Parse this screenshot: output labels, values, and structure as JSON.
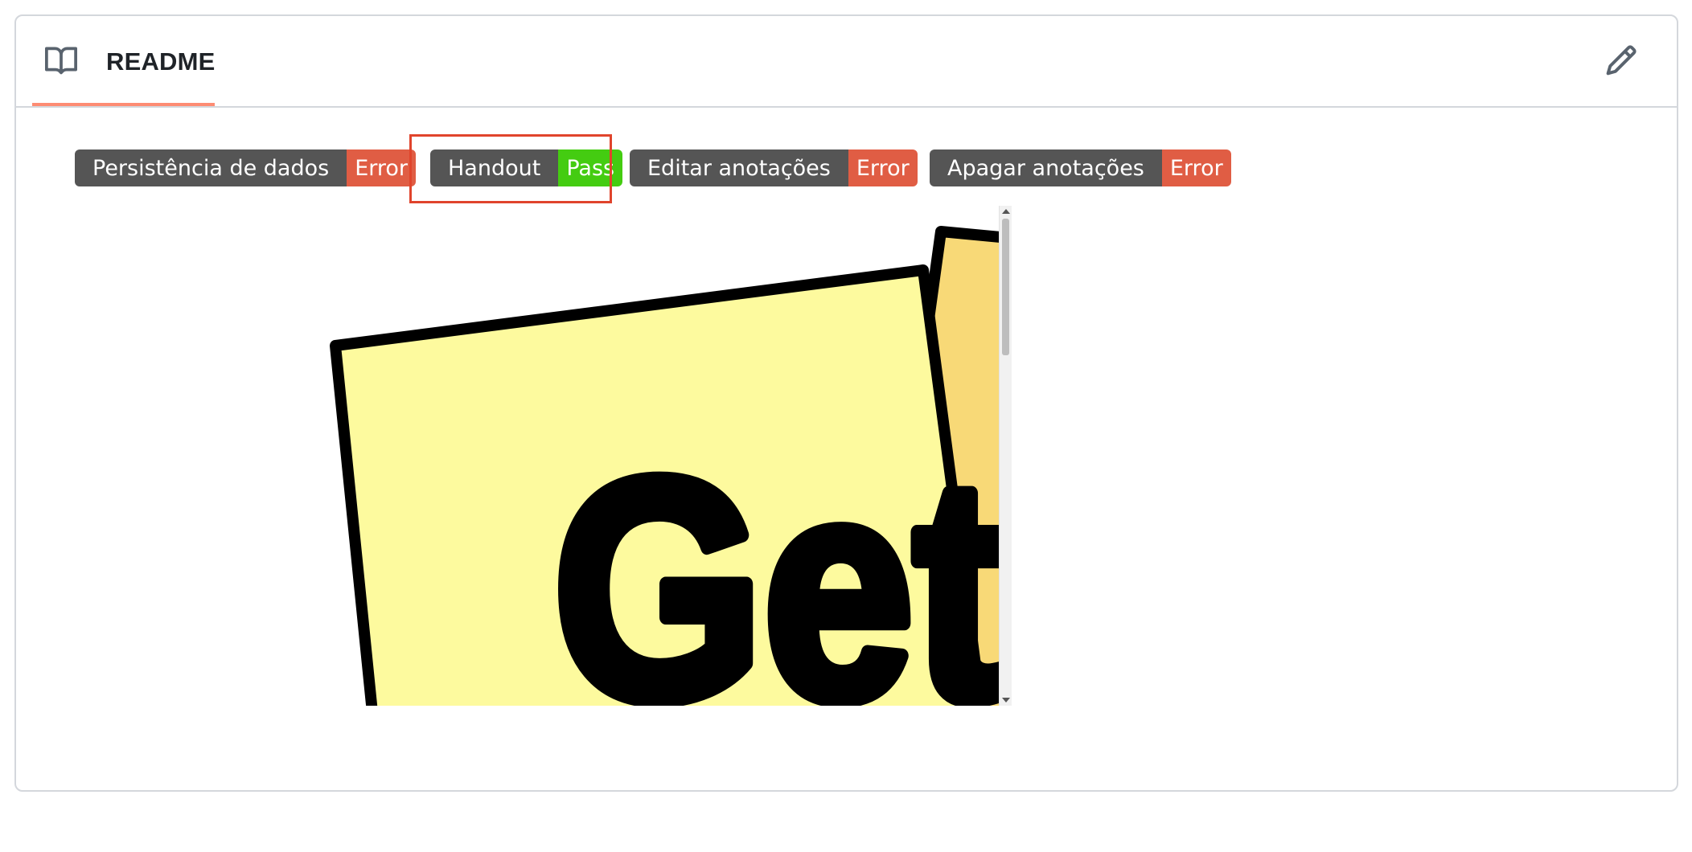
{
  "readme": {
    "title": "README",
    "icon": "book-icon",
    "edit_icon": "pencil-icon"
  },
  "badges": [
    {
      "label": "Persistência de dados",
      "status": "Error",
      "status_color": "#e05d44"
    },
    {
      "label": "Handout",
      "status": "Pass",
      "status_color": "#44cc11"
    },
    {
      "label": "Editar anotações",
      "status": "Error",
      "status_color": "#e05d44"
    },
    {
      "label": "Apagar anotações",
      "status": "Error",
      "status_color": "#e05d44"
    }
  ],
  "embedded_image": {
    "text": "Get",
    "note_color": "#fdfa9e",
    "note_back_color": "#f8d977"
  },
  "colors": {
    "accent_underline": "#fd8c73",
    "highlight_border": "#e0442c",
    "badge_label_bg": "#555555"
  }
}
